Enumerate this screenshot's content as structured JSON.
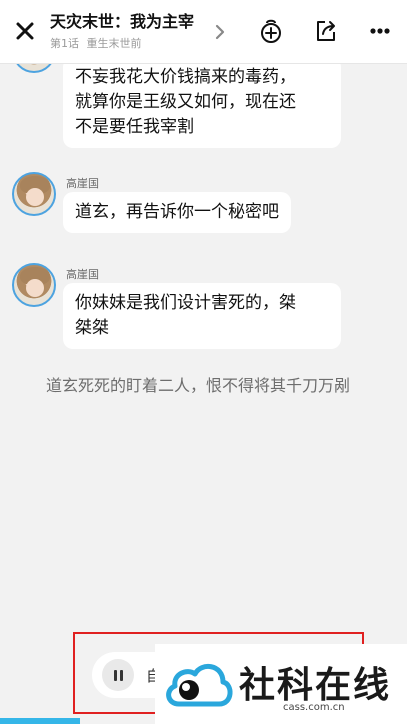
{
  "header": {
    "title": "天灾末世：我为主宰",
    "episode": "第1话",
    "chapter_name": "重生末世前"
  },
  "messages": [
    {
      "sender": "",
      "text": "不妄我花大价钱搞来的毒药，\n就算你是王级又如何，现在还\n不是要任我宰割"
    },
    {
      "sender": "高崖国",
      "text": "道玄，再告诉你一个秘密吧"
    },
    {
      "sender": "高崖国",
      "text": "你妹妹是我们设计害死的，桀\n桀桀"
    }
  ],
  "narration": "道玄死死的盯着二人，恨不得将其千刀万剐",
  "controls": {
    "auto_label": "自"
  },
  "watermark": {
    "brand": "社科在线",
    "url": "cass.com.cn"
  },
  "colors": {
    "avatar_border": "#4da3e0",
    "progress": "#35b6e8",
    "highlight_frame": "#e02020"
  }
}
